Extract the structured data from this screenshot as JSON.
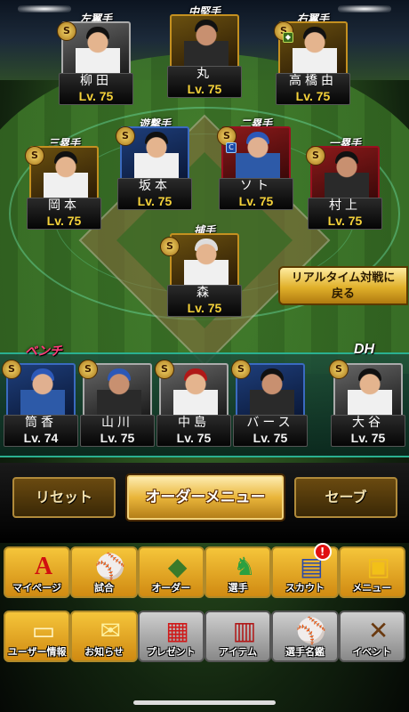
{
  "lineup": [
    {
      "id": "lf",
      "position": "左翼手",
      "name": "柳田",
      "level": "Lv. 75"
    },
    {
      "id": "cf",
      "position": "中堅手",
      "name": "丸",
      "level": "Lv. 75"
    },
    {
      "id": "rf",
      "position": "右翼手",
      "name": "高橋由",
      "level": "Lv. 75"
    },
    {
      "id": "ss",
      "position": "遊撃手",
      "name": "坂本",
      "level": "Lv. 75"
    },
    {
      "id": "2b",
      "position": "二塁手",
      "name": "ソト",
      "level": "Lv. 75"
    },
    {
      "id": "3b",
      "position": "三塁手",
      "name": "岡本",
      "level": "Lv. 75"
    },
    {
      "id": "1b",
      "position": "一塁手",
      "name": "村上",
      "level": "Lv. 75"
    },
    {
      "id": "c",
      "position": "捕手",
      "name": "森",
      "level": "Lv. 75"
    }
  ],
  "bench": {
    "label": "ベンチ",
    "players": [
      {
        "name": "筒香",
        "level": "Lv. 74"
      },
      {
        "name": "山川",
        "level": "Lv. 75"
      },
      {
        "name": "中島",
        "level": "Lv. 75"
      },
      {
        "name": "バース",
        "level": "Lv. 75"
      }
    ]
  },
  "dh": {
    "label": "DH",
    "name": "大谷",
    "level": "Lv. 75"
  },
  "realtime_button": {
    "line1": "リアルタイム対戦に",
    "line2": "戻る"
  },
  "order_bar": {
    "reset": "リセット",
    "order_menu": "オーダーメニュー",
    "save": "セーブ"
  },
  "main_menu": [
    {
      "label": "マイページ",
      "icon": "my-page-icon",
      "glyph": "A"
    },
    {
      "label": "試合",
      "icon": "stadium-icon",
      "glyph": "⚾"
    },
    {
      "label": "オーダー",
      "icon": "field-order-icon",
      "glyph": "◆"
    },
    {
      "label": "選手",
      "icon": "player-icon",
      "glyph": "♞"
    },
    {
      "label": "スカウト",
      "icon": "scout-card-icon",
      "glyph": "▤",
      "badge": "!"
    },
    {
      "label": "メニュー",
      "icon": "menu-box-icon",
      "glyph": "▣"
    }
  ],
  "sub_menu": [
    {
      "label": "ユーザー情報",
      "icon": "user-info-icon",
      "glyph": "▭"
    },
    {
      "label": "お知らせ",
      "icon": "notice-icon",
      "glyph": "✉"
    },
    {
      "label": "プレゼント",
      "icon": "present-icon",
      "glyph": "▦"
    },
    {
      "label": "アイテム",
      "icon": "item-book-icon",
      "glyph": "▥"
    },
    {
      "label": "選手名鑑",
      "icon": "player-directory-icon",
      "glyph": "⚾"
    },
    {
      "label": "イベント",
      "icon": "event-bats-icon",
      "glyph": "✕"
    }
  ],
  "colors": {
    "accent_gold": "#e9b53a",
    "level_yellow": "#f5d23a",
    "bench_pink": "#ff3a78",
    "badge_red": "#e01010"
  }
}
